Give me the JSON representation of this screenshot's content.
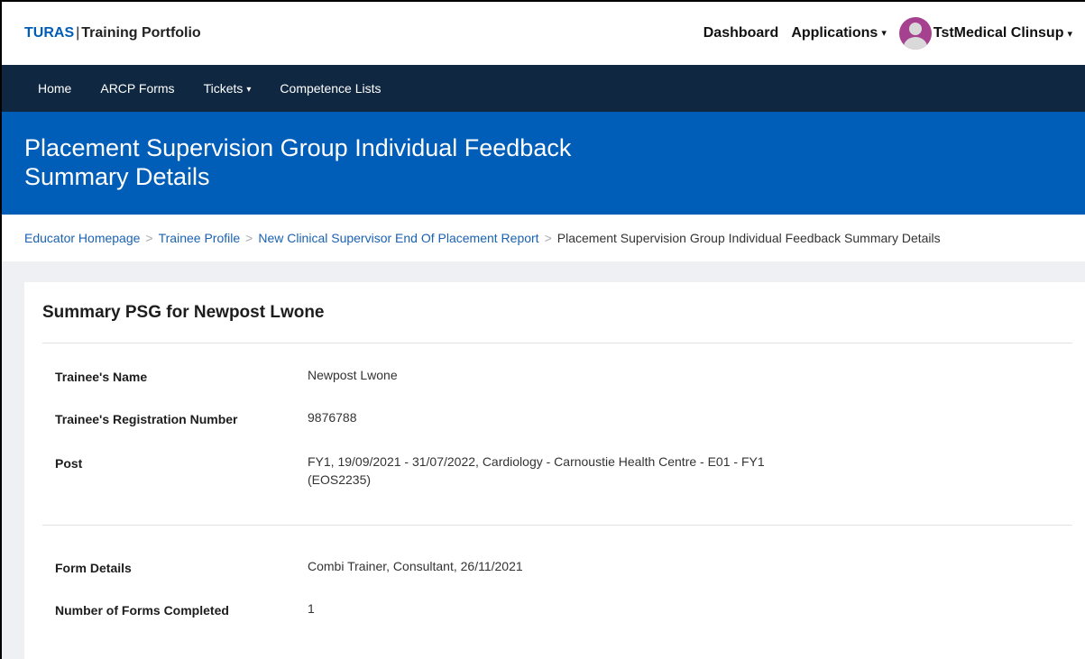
{
  "brand": {
    "name": "TURAS",
    "separator": "|",
    "product": "Training Portfolio"
  },
  "topnav": {
    "dashboard": "Dashboard",
    "applications": "Applications",
    "user_name": "TstMedical Clinsup"
  },
  "subnav": {
    "home": "Home",
    "arcp_forms": "ARCP Forms",
    "tickets": "Tickets",
    "competence_lists": "Competence Lists"
  },
  "page": {
    "title": "Placement Supervision Group Individual Feedback Summary Details"
  },
  "breadcrumb": {
    "items": [
      "Educator Homepage",
      "Trainee Profile",
      "New Clinical Supervisor End Of Placement Report"
    ],
    "separator": ">",
    "current": "Placement Supervision Group Individual Feedback Summary Details"
  },
  "summary": {
    "title": "Summary PSG for Newpost Lwone",
    "fields": [
      {
        "label": "Trainee's Name",
        "value": "Newpost Lwone"
      },
      {
        "label": "Trainee's Registration Number",
        "value": "9876788"
      },
      {
        "label": "Post",
        "value": "FY1, 19/09/2021 - 31/07/2022, Cardiology - Carnoustie Health Centre - E01 - FY1 (EOS2235)"
      },
      {
        "label": "Form Details",
        "value": "Combi Trainer, Consultant, 26/11/2021"
      },
      {
        "label": "Number of Forms Completed",
        "value": "1"
      }
    ]
  }
}
